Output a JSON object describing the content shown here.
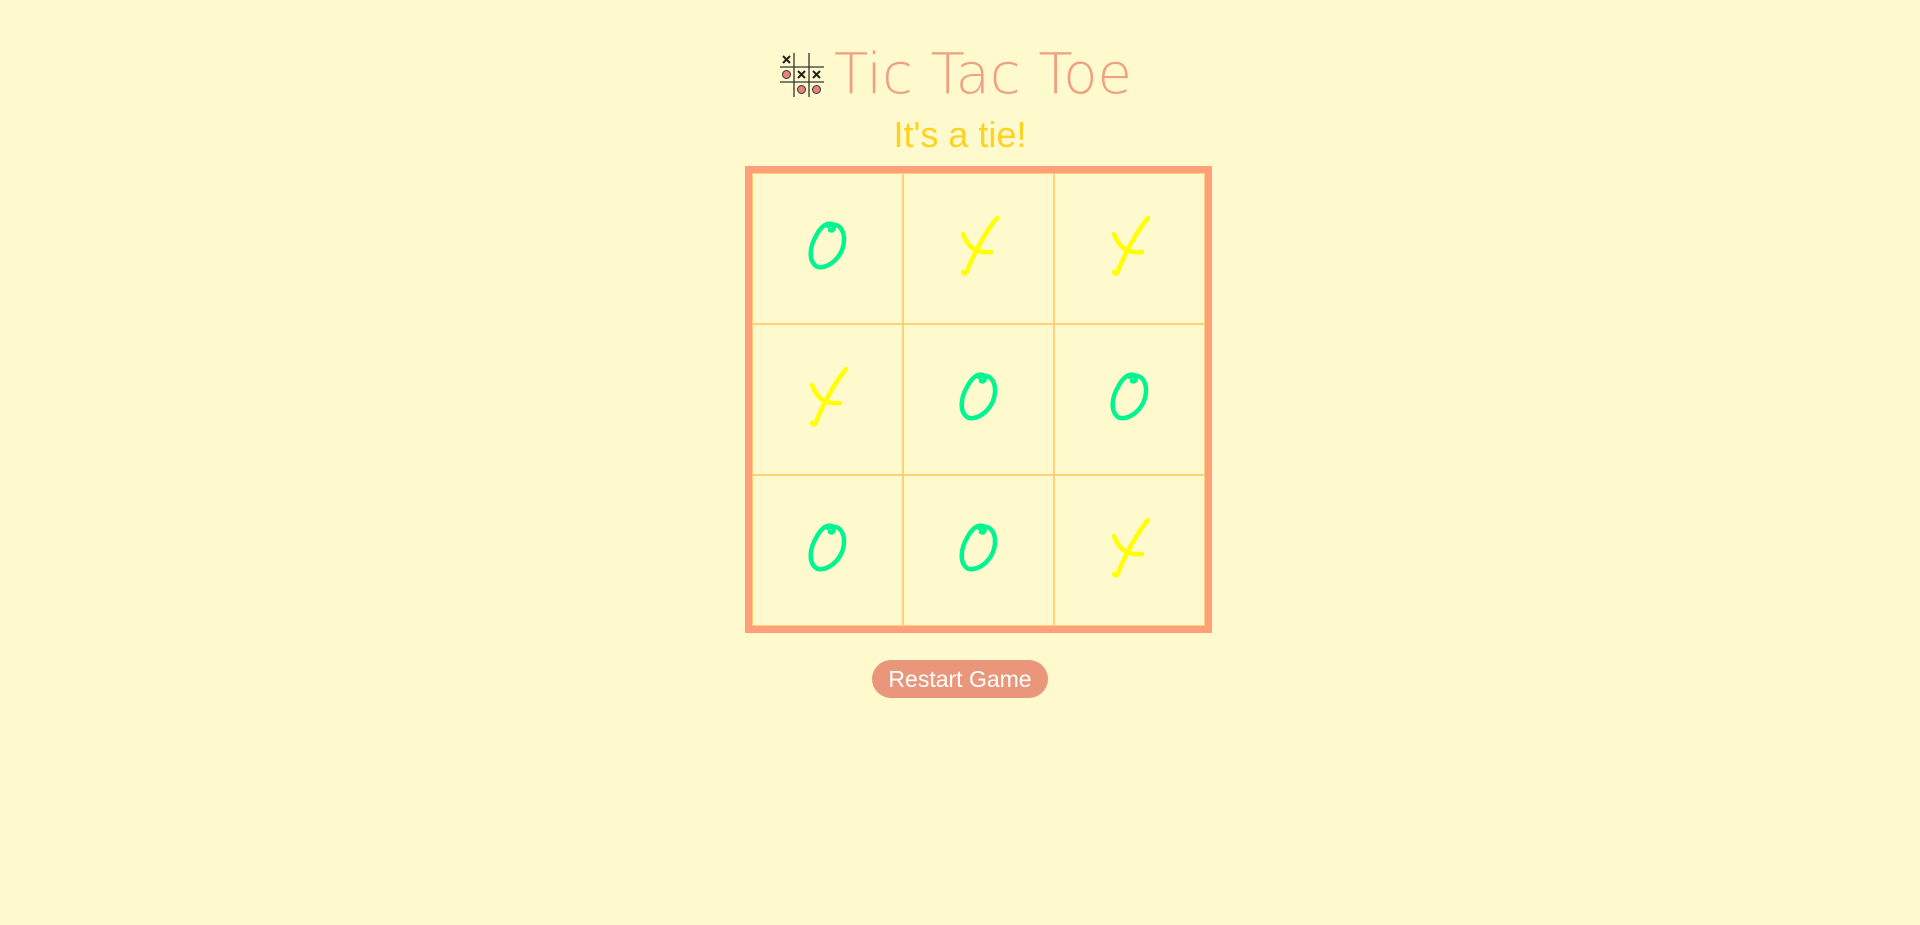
{
  "header": {
    "title": "Tic Tac Toe",
    "logo_icon": "tic-tac-toe-logo-icon"
  },
  "status": {
    "text": "It's a tie!"
  },
  "board": {
    "cells": [
      "O",
      "X",
      "X",
      "X",
      "O",
      "O",
      "O",
      "O",
      "X"
    ],
    "x_color": "#ffff00",
    "o_color": "#00f590"
  },
  "controls": {
    "restart_label": "Restart Game"
  },
  "colors": {
    "background": "#fffacd",
    "title": "#f0a080",
    "status": "#ffd21f",
    "board_border": "#ffa07a",
    "cell_border": "#ffd27a",
    "button": "#e9967a"
  }
}
